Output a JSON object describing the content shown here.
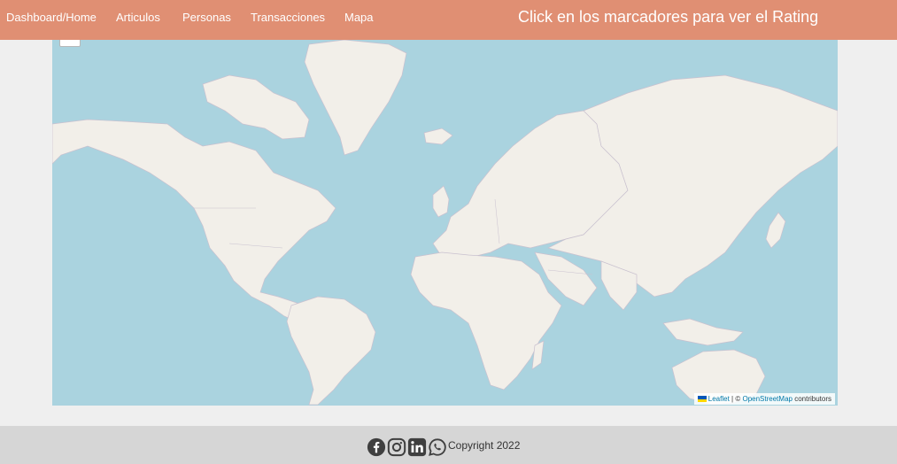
{
  "nav": {
    "items": [
      {
        "label": "Dashboard/Home"
      },
      {
        "label": "Articulos"
      },
      {
        "label": "Personas"
      },
      {
        "label": "Transacciones"
      },
      {
        "label": "Mapa"
      }
    ],
    "hint": "Click en los marcadores para ver el Rating"
  },
  "map": {
    "colors": {
      "water": "#aad3df",
      "land": "#f2efe9",
      "border": "#b9b2c1"
    },
    "attribution": {
      "leaflet": "Leaflet",
      "separator": "| ©",
      "osm": "OpenStreetMap",
      "suffix": "contributors"
    }
  },
  "footer": {
    "icons": [
      "facebook-icon",
      "instagram-icon",
      "linkedin-icon",
      "whatsapp-icon"
    ],
    "copyright": "Copyright 2022"
  },
  "theme": {
    "navbar": "#e08f73",
    "page": "#efefef",
    "footer": "#d6d6d6"
  }
}
